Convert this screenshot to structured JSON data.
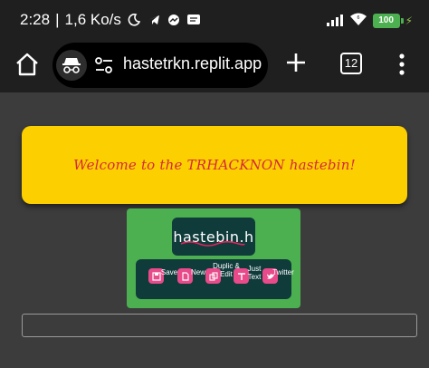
{
  "status_bar": {
    "time": "2:28",
    "network_speed": "1,6 Ko/s",
    "battery": "100"
  },
  "browser": {
    "url": "hastetrkn.replit.app",
    "tab_count": "12"
  },
  "page": {
    "welcome": "Welcome to the TRHACKNON hastebin!",
    "logo": "hastebin.h",
    "actions": [
      {
        "label": "Save",
        "icon": "save-icon"
      },
      {
        "label": "New",
        "icon": "new-icon"
      },
      {
        "label": "Duplic & Edit",
        "icon": "duplicate-icon"
      },
      {
        "label": "Just Text",
        "icon": "text-icon"
      },
      {
        "label": "Twitter",
        "icon": "twitter-icon"
      }
    ],
    "colors": {
      "banner": "#fccf00",
      "banner_text": "#d6283b",
      "panel": "#4caf50",
      "dark_teal": "#0f3b3b",
      "action_icon": "#e84a8a"
    }
  }
}
